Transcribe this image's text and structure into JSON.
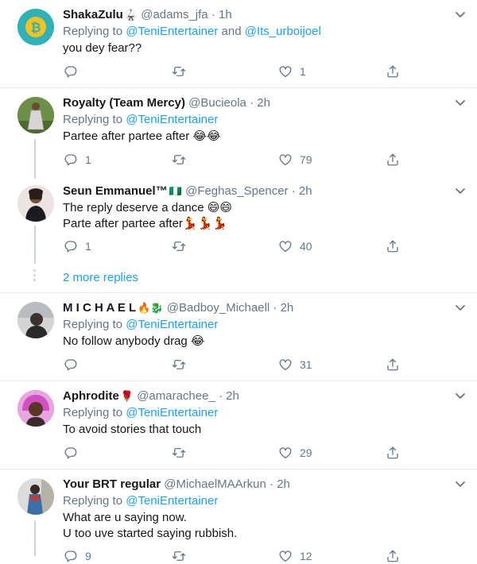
{
  "tweets": [
    {
      "name": "ShakaZulu",
      "name_badge": "🥋",
      "handle": "@adams_jfa",
      "time": "1h",
      "replying_label": "Replying to",
      "mention_1": "@TeniEntertainer",
      "and_label": "and",
      "mention_2": "@Its_urboijoel",
      "lines": [
        "you dey fear??"
      ],
      "reply_count": "",
      "retweet_count": "",
      "like_count": "1"
    },
    {
      "name": "Royalty (Team Mercy)",
      "handle": "@Bucieola",
      "time": "2h",
      "replying_label": "Replying to",
      "mention_1": "@TeniEntertainer",
      "lines": [
        "Partee after partee after 😂😂"
      ],
      "reply_count": "1",
      "retweet_count": "",
      "like_count": "79"
    },
    {
      "name": "Seun Emmanuel™",
      "name_badge": "🇳🇬",
      "handle": "@Feghas_Spencer",
      "time": "2h",
      "lines": [
        "The reply deserve a dance 😄😄",
        "Parte after partee after💃💃💃"
      ],
      "reply_count": "1",
      "retweet_count": "",
      "like_count": "40"
    },
    {
      "name": "M I C H A E L",
      "name_badge": "🔥🐉",
      "handle": "@Badboy_Michaell",
      "time": "2h",
      "replying_label": "Replying to",
      "mention_1": "@TeniEntertainer",
      "lines": [
        "No follow anybody drag 😂"
      ],
      "reply_count": "",
      "retweet_count": "",
      "like_count": "31"
    },
    {
      "name": "Aphrodite",
      "name_badge": "🌹",
      "handle": "@amarachee_",
      "time": "2h",
      "replying_label": "Replying to",
      "mention_1": "@TeniEntertainer",
      "lines": [
        "To avoid stories that touch"
      ],
      "reply_count": "",
      "retweet_count": "",
      "like_count": "29"
    },
    {
      "name": "Your BRT regular",
      "handle": "@MichaelMAArkun",
      "time": "2h",
      "replying_label": "Replying to",
      "mention_1": "@TeniEntertainer",
      "lines": [
        "What are u saying now.",
        "U too uve started saying rubbish."
      ],
      "reply_count": "9",
      "retweet_count": "",
      "like_count": "12"
    }
  ],
  "more_replies": "2 more replies",
  "dot": "·",
  "icons": {
    "reply": "reply-icon",
    "retweet": "retweet-icon",
    "like": "heart-icon",
    "share": "share-icon",
    "menu": "chevron-down-icon"
  },
  "colors": {
    "link": "#1da1f2",
    "muted": "#657786",
    "text": "#14171a",
    "divider": "#e6ecf0",
    "thread": "#ccd6dd"
  }
}
